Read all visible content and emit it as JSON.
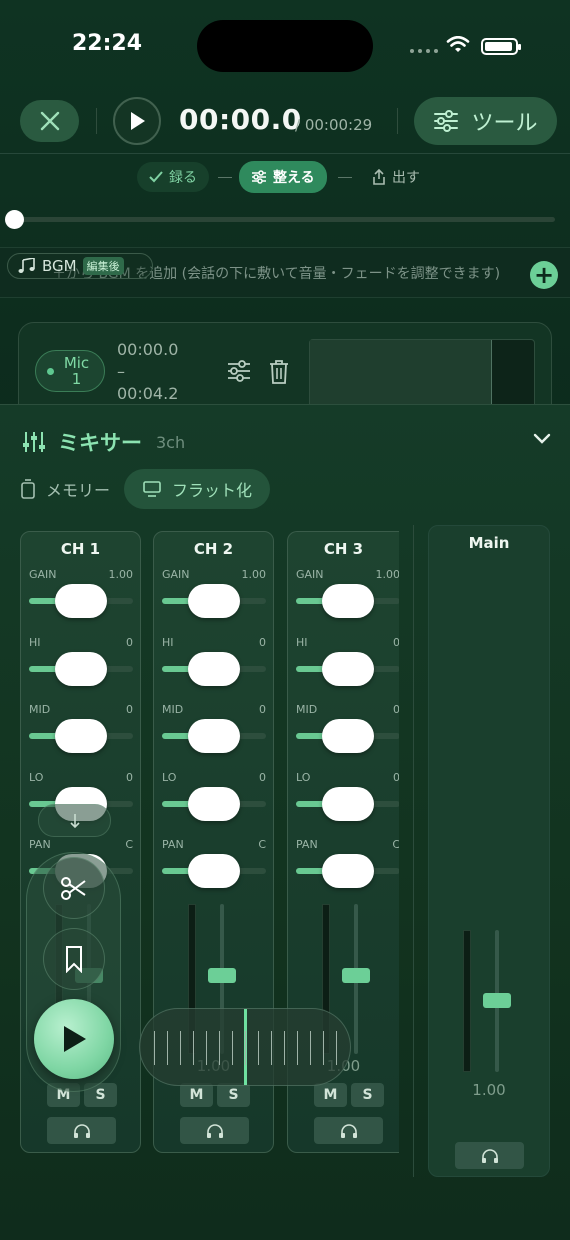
{
  "status": {
    "time": "22:24"
  },
  "toolbar": {
    "timecode": "00:00.0",
    "total": "/ 00:00:29",
    "tools_label": "ツール"
  },
  "steps": {
    "record": "録る",
    "edit": "整える",
    "export": "出す"
  },
  "timeline": {
    "position": 0
  },
  "bgm": {
    "label": "BGM",
    "badge": "編集後",
    "hint": "＋から BGM を追加 (会話の下に敷いて音量・フェードを調整できます)",
    "add": "+"
  },
  "clip": {
    "mic": "Mic 1",
    "start": "00:00.0",
    "dash": "–",
    "end": "00:04.2"
  },
  "mixer": {
    "title": "ミキサー",
    "count": "3ch",
    "memory_label": "メモリー",
    "flat_label": "フラット化",
    "channels": [
      {
        "name": "CH 1",
        "gain": "1.00",
        "hi": "0",
        "mid": "0",
        "lo": "0",
        "pan": "C",
        "level": "1.00"
      },
      {
        "name": "CH 2",
        "gain": "1.00",
        "hi": "0",
        "mid": "0",
        "lo": "0",
        "pan": "C",
        "level": "1.00"
      },
      {
        "name": "CH 3",
        "gain": "1.00",
        "hi": "0",
        "mid": "0",
        "lo": "0",
        "pan": "C",
        "level": "1.00"
      }
    ],
    "labels": {
      "gain": "GAIN",
      "hi": "HI",
      "mid": "MID",
      "lo": "LO",
      "pan": "PAN",
      "mute": "M",
      "solo": "S"
    },
    "main": {
      "name": "Main",
      "level": "1.00"
    }
  },
  "colors": {
    "accent": "#6ccf97",
    "background": "#0f3322"
  }
}
